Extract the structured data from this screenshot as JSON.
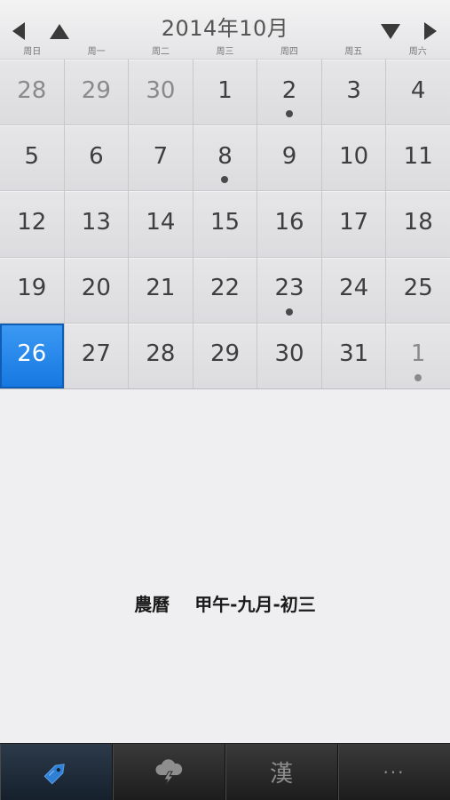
{
  "header": {
    "title": "2014年10月",
    "weekdays": [
      "周日",
      "周一",
      "周二",
      "周三",
      "周四",
      "周五",
      "周六"
    ]
  },
  "calendar": {
    "cells": [
      {
        "day": "28",
        "other": true,
        "dot": false,
        "today": false
      },
      {
        "day": "29",
        "other": true,
        "dot": false,
        "today": false
      },
      {
        "day": "30",
        "other": true,
        "dot": false,
        "today": false
      },
      {
        "day": "1",
        "other": false,
        "dot": false,
        "today": false
      },
      {
        "day": "2",
        "other": false,
        "dot": true,
        "today": false
      },
      {
        "day": "3",
        "other": false,
        "dot": false,
        "today": false
      },
      {
        "day": "4",
        "other": false,
        "dot": false,
        "today": false
      },
      {
        "day": "5",
        "other": false,
        "dot": false,
        "today": false
      },
      {
        "day": "6",
        "other": false,
        "dot": false,
        "today": false
      },
      {
        "day": "7",
        "other": false,
        "dot": false,
        "today": false
      },
      {
        "day": "8",
        "other": false,
        "dot": true,
        "today": false
      },
      {
        "day": "9",
        "other": false,
        "dot": false,
        "today": false
      },
      {
        "day": "10",
        "other": false,
        "dot": false,
        "today": false
      },
      {
        "day": "11",
        "other": false,
        "dot": false,
        "today": false
      },
      {
        "day": "12",
        "other": false,
        "dot": false,
        "today": false
      },
      {
        "day": "13",
        "other": false,
        "dot": false,
        "today": false
      },
      {
        "day": "14",
        "other": false,
        "dot": false,
        "today": false
      },
      {
        "day": "15",
        "other": false,
        "dot": false,
        "today": false
      },
      {
        "day": "16",
        "other": false,
        "dot": false,
        "today": false
      },
      {
        "day": "17",
        "other": false,
        "dot": false,
        "today": false
      },
      {
        "day": "18",
        "other": false,
        "dot": false,
        "today": false
      },
      {
        "day": "19",
        "other": false,
        "dot": false,
        "today": false
      },
      {
        "day": "20",
        "other": false,
        "dot": false,
        "today": false
      },
      {
        "day": "21",
        "other": false,
        "dot": false,
        "today": false
      },
      {
        "day": "22",
        "other": false,
        "dot": false,
        "today": false
      },
      {
        "day": "23",
        "other": false,
        "dot": true,
        "today": false
      },
      {
        "day": "24",
        "other": false,
        "dot": false,
        "today": false
      },
      {
        "day": "25",
        "other": false,
        "dot": false,
        "today": false
      },
      {
        "day": "26",
        "other": false,
        "dot": false,
        "today": true
      },
      {
        "day": "27",
        "other": false,
        "dot": false,
        "today": false
      },
      {
        "day": "28",
        "other": false,
        "dot": false,
        "today": false
      },
      {
        "day": "29",
        "other": false,
        "dot": false,
        "today": false
      },
      {
        "day": "30",
        "other": false,
        "dot": false,
        "today": false
      },
      {
        "day": "31",
        "other": false,
        "dot": false,
        "today": false
      },
      {
        "day": "1",
        "other": true,
        "dot": true,
        "today": false
      }
    ]
  },
  "lunar": {
    "label": "農曆",
    "value": "甲午-九月-初三"
  },
  "tabbar": {
    "han_label": "漢",
    "more_label": "···"
  },
  "colors": {
    "accent": "#1a7fe6",
    "tag_icon": "#2f7fd6"
  }
}
